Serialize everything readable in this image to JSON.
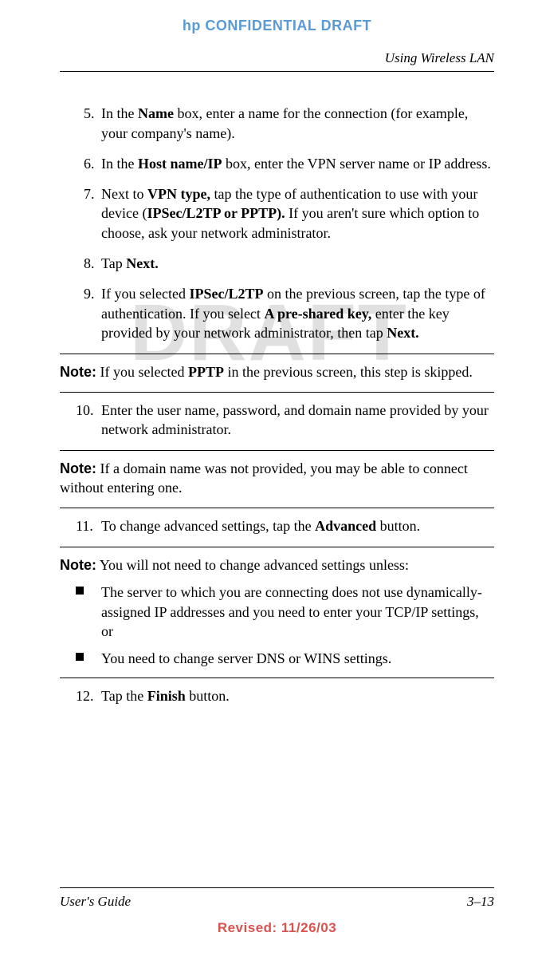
{
  "header": {
    "confidential": "hp CONFIDENTIAL DRAFT",
    "section": "Using Wireless LAN"
  },
  "watermark": "DRAFT",
  "steps": {
    "s5": {
      "num": "5.",
      "pre": "In the ",
      "b1": "Name",
      "post": " box, enter a name for the connection (for example, your company's name)."
    },
    "s6": {
      "num": "6.",
      "pre": "In the ",
      "b1": "Host name/IP",
      "post": " box, enter the VPN server name or IP address."
    },
    "s7": {
      "num": "7.",
      "pre": "Next to ",
      "b1": "VPN type,",
      "mid": " tap the type of authentication to use with your device (",
      "b2": "IPSec/L2TP or PPTP).",
      "post": " If you aren't sure which option to choose, ask your network administrator."
    },
    "s8": {
      "num": "8.",
      "pre": "Tap ",
      "b1": "Next."
    },
    "s9": {
      "num": "9.",
      "pre": "If you selected ",
      "b1": "IPSec/L2TP",
      "mid1": " on the previous screen, tap the type of authentication. If you select ",
      "b2": "A pre-shared key,",
      "mid2": " enter the key provided by your network administrator, then tap ",
      "b3": "Next."
    },
    "s10": {
      "num": "10.",
      "text": "Enter the user name, password, and domain name provided by your network administrator."
    },
    "s11": {
      "num": "11.",
      "pre": "To change advanced settings, tap the ",
      "b1": "Advanced",
      "post": " button."
    },
    "s12": {
      "num": "12.",
      "pre": "Tap the ",
      "b1": "Finish",
      "post": " button."
    }
  },
  "notes": {
    "label": "Note:",
    "n1": {
      "pre": " If you selected ",
      "b1": "PPTP",
      "post": " in the previous screen, this step is skipped."
    },
    "n2": " If a domain name was not provided, you may be able to connect without entering one.",
    "n3": " You will not need to change advanced settings unless:",
    "bullets": {
      "b1": "The server to which you are connecting does not use dynamically-assigned IP addresses and you need to enter your TCP/IP settings,\nor",
      "b2": "You need to change server DNS or WINS settings."
    }
  },
  "footer": {
    "left": "User's Guide",
    "right": "3–13",
    "revised": "Revised: 11/26/03"
  }
}
